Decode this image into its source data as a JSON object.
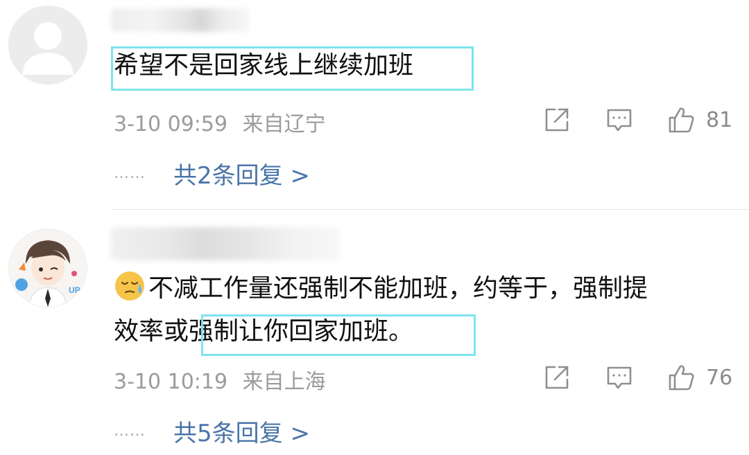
{
  "comments": [
    {
      "text": "希望不是回家线上继续加班",
      "time": "3-10 09:59",
      "location": "来自辽宁",
      "likes": "81",
      "reply_text": "共2条回复 >",
      "dots": "……",
      "avatar_icon": "default-avatar-icon"
    },
    {
      "text_line1": "不减工作量还强制不能加班，约等于，强制提",
      "text_line2": "效率或强制让你回家加班。",
      "emoji": "sweat-emoji-icon",
      "time": "3-10 10:19",
      "location": "来自上海",
      "likes": "76",
      "reply_text": "共5条回复 >",
      "dots": "……",
      "avatar_icon": "cartoon-avatar-icon"
    }
  ],
  "colors": {
    "highlight": "#7fe3ee",
    "link": "#4a74a8",
    "meta": "#9b9b9b"
  }
}
